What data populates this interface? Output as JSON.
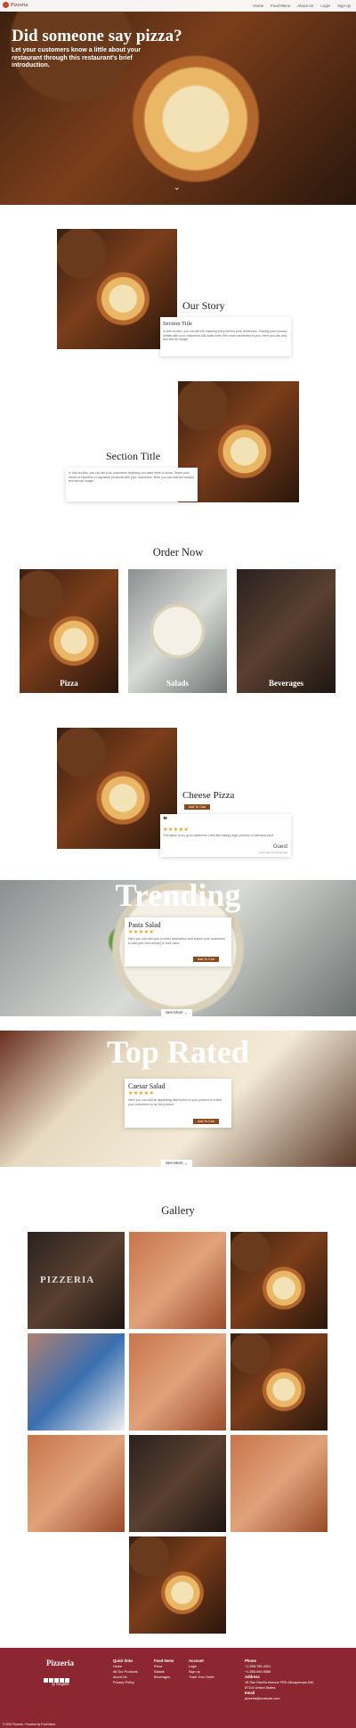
{
  "brand": {
    "name": "Pizzeria"
  },
  "nav": [
    "Home",
    "Food Menu",
    "About Us",
    "Login",
    "Sign up"
  ],
  "hero": {
    "title": "Did someone say pizza?",
    "subtitle": "Let your customers know a little about your restaurant through this restaurant's brief introduction."
  },
  "story": {
    "heading": "Our Story",
    "card_title": "Section Title",
    "card_text": "In this section, you can tell the inspiring story behind your restaurant. Sharing your journey details with your customers will make them feel more connected to you. Here you can add text and an image."
  },
  "section2": {
    "heading": "Section Title",
    "card_text": "In this section, you can tell your customers anything you want them to know. Share your areas of expertise or signature products with your customers. Here you can add the section text and an image."
  },
  "order": {
    "heading": "Order Now",
    "categories": [
      "Pizza",
      "Salads",
      "Beverages"
    ]
  },
  "featured": {
    "title": "Cheese Pizza",
    "button": "Add To Cart",
    "quote_mark": "❝",
    "stars": "★★★★★",
    "review": "This place is my go-to whenever I feel like eating huge portions of delicious food.",
    "author": "Guest",
    "time": "more than 3 months ago"
  },
  "trending": {
    "heading": "Trending",
    "item": "Pasta Salad",
    "stars": "★★★★★",
    "text": "Here you can add your product description and inspire your customers to add your food item(s) to their carts.",
    "button": "Add To Cart",
    "see_more": "See More"
  },
  "toprated": {
    "heading": "Top Rated",
    "item": "Caesar Salad",
    "stars": "★★★★★",
    "text": "Here you can add an appealing description of your product to entice your customers to try the product.",
    "button": "Add To Cart",
    "see_more": "See More"
  },
  "gallery": {
    "heading": "Gallery",
    "sign_text": "PIZZERIA"
  },
  "footer": {
    "brand": "Pizzeria",
    "language": "English",
    "quick_links": {
      "title": "Quick links",
      "items": [
        "Home",
        "All Our Products",
        "About Us",
        "Privacy Policy"
      ]
    },
    "food_items": {
      "title": "Food Items",
      "items": [
        "Pizza",
        "Salads",
        "Beverages"
      ]
    },
    "account": {
      "title": "Account",
      "items": [
        "Login",
        "Sign up",
        "Track Your Order"
      ]
    },
    "phone": {
      "title": "Phone",
      "items": [
        "+1-555-755-4321",
        "+1-555-649-9866"
      ]
    },
    "address": {
      "title": "Address",
      "items": [
        "15 San Diseño Avenue FRD Albuquerque,NM,",
        "87104 United States"
      ]
    },
    "email": {
      "title": "Email",
      "items": [
        "pizzeria@example.com"
      ]
    },
    "copyright": "© 2024 Pizzeria - Powered by Food Menu"
  },
  "colors": {
    "accent": "#8b4a1e",
    "footer": "#8c2731",
    "stars": "#e3a21a"
  }
}
